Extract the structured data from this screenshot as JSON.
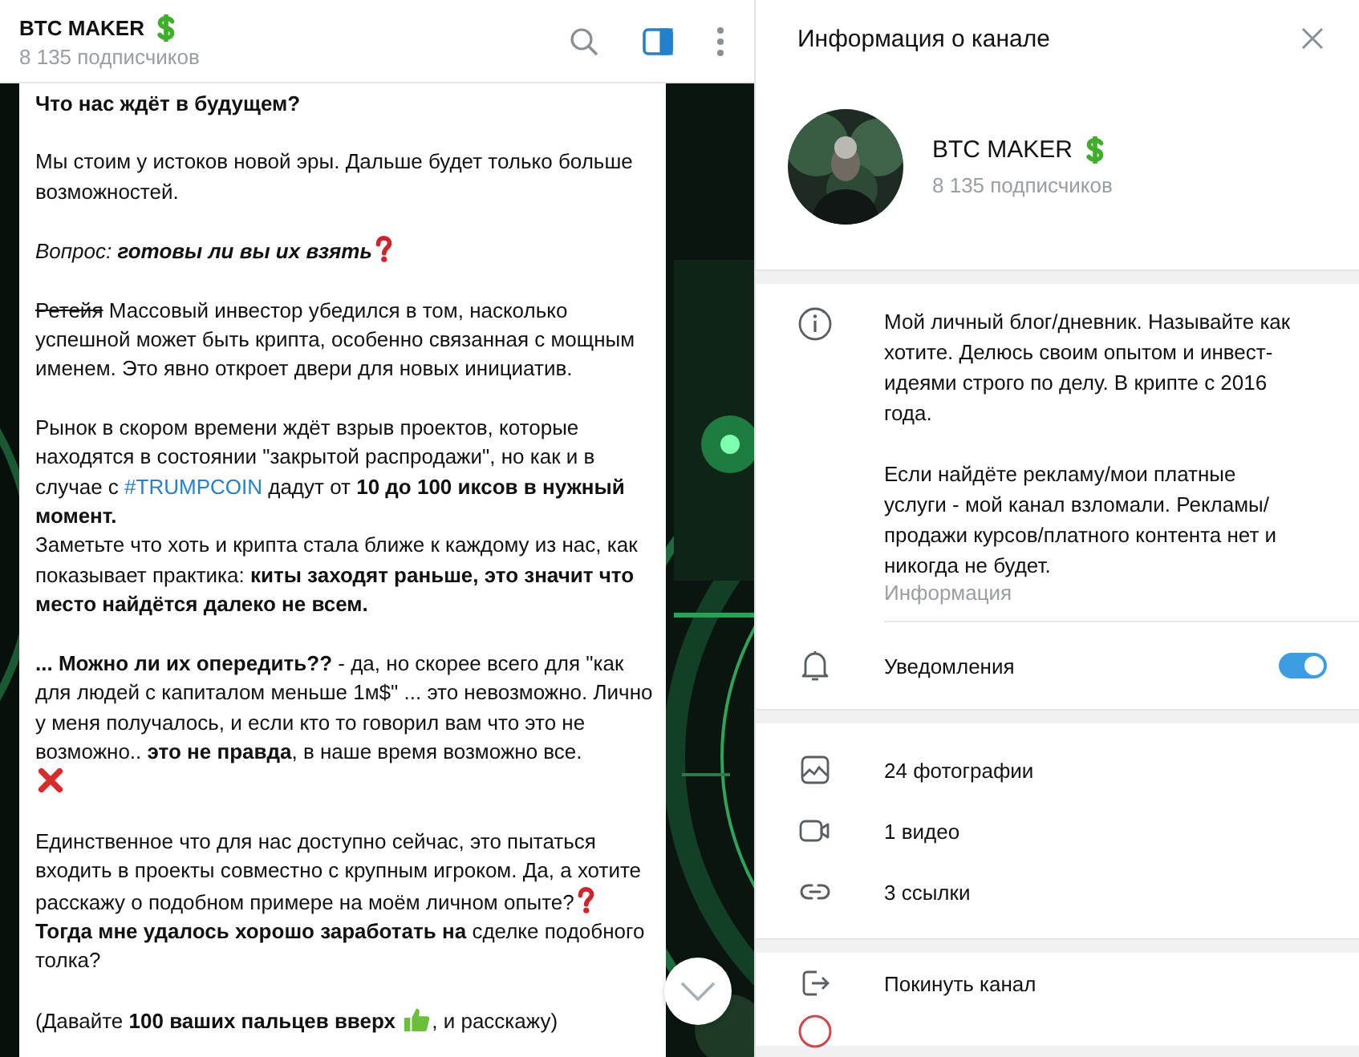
{
  "chat_header": {
    "title": "BTC MAKER",
    "subtitle": "8 135 подписчиков",
    "info_panel_open": true
  },
  "message": {
    "paragraphs": [
      {
        "kind": "heading",
        "runs": [
          {
            "kind": "text",
            "text": "Что нас ждёт в будущем?"
          }
        ]
      },
      {
        "kind": "body",
        "runs": [
          {
            "kind": "text",
            "text": "Мы стоим у истоков новой эры. Дальше будет только больше возможностей."
          }
        ]
      },
      {
        "kind": "question",
        "runs": [
          {
            "kind": "text",
            "text": "Вопрос: **готовы ли вы их взять**"
          },
          {
            "kind": "question-mark"
          }
        ]
      },
      {
        "kind": "body",
        "runs": [
          {
            "kind": "strike",
            "text": "Ретейя"
          },
          {
            "kind": "text",
            "text": " Массовый инвестор убедился в том, насколько успешной может быть крипта, особенно связанная с мощным именем. Это явно откроет двери для новых инициатив."
          }
        ]
      },
      {
        "kind": "body",
        "runs": [
          {
            "kind": "text",
            "text": "Рынок в скором времени ждёт взрыв проектов, которые находятся в состоянии \"закрытой распродажи\", но как и в случае с "
          },
          {
            "kind": "hashtag",
            "text": "#TRUMPCOIN"
          },
          {
            "kind": "text",
            "text": " дадут от **10 до 100 иксов в нужный момент.**"
          },
          {
            "kind": "break"
          },
          {
            "kind": "text",
            "text": "Заметьте что хоть и крипта стала ближе к каждому из нас, как показывает практика: **киты заходят раньше, это значит что место найдётся далеко не всем.**"
          }
        ]
      },
      {
        "kind": "body",
        "runs": [
          {
            "kind": "text",
            "text": "**... Можно ли их опередить??** - да, но скорее всего для \"как для людей с капиталом меньше 1м$\" ... это невозможно. Лично у меня получалось, и если кто то говорил вам что это не возможно.. **это не правда**, в наше время возможно все."
          },
          {
            "kind": "break"
          },
          {
            "kind": "cross-mark"
          }
        ]
      },
      {
        "kind": "body",
        "runs": [
          {
            "kind": "text",
            "text": "Единственное что для нас доступно сейчас, это пытаться входить в проекты совместно с крупным игроком. Да, а хотите расскажу о подобном примере на моём личном опыте?"
          },
          {
            "kind": "question-mark"
          },
          {
            "kind": "text",
            "text": "**Тогда мне удалось хорошо заработать на** сделке подобного толка?"
          }
        ]
      },
      {
        "kind": "body",
        "runs": [
          {
            "kind": "text",
            "text": "(Давайте **100 ваших пальцев вверх** "
          },
          {
            "kind": "thumbs-up"
          },
          {
            "kind": "text",
            "text": ", и расскажу)"
          }
        ]
      }
    ]
  },
  "info_panel": {
    "title": "Информация о канале",
    "channel": {
      "name": "BTC MAKER",
      "subscribers": "8 135 подписчиков"
    },
    "description": [
      "Мой личный блог/дневник. Называйте как хотите. Делюсь своим опытом и инвест-идеями строго по делу. В крипте с 2016 года.",
      "Если найдёте рекламу/мои платные услуги - мой канал взломали. Рекламы/продажи курсов/платного контента нет и никогда не будет."
    ],
    "description_label": "Информация",
    "notifications": {
      "label": "Уведомления",
      "on": true
    },
    "media": [
      {
        "kind": "photos",
        "label": "24 фотографии"
      },
      {
        "kind": "video",
        "label": "1 видео"
      },
      {
        "kind": "links",
        "label": "3 ссылки"
      }
    ],
    "actions": [
      {
        "kind": "leave",
        "label": "Покинуть канал"
      }
    ]
  }
}
